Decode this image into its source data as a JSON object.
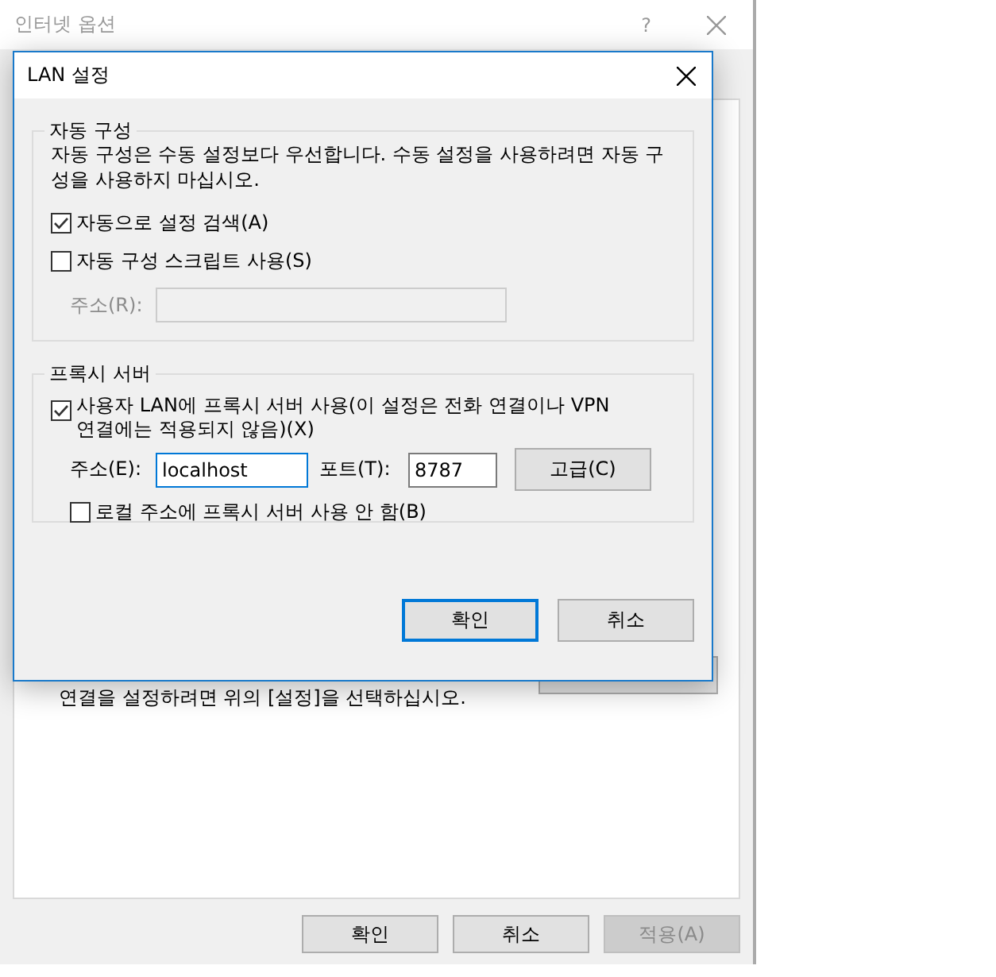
{
  "main_window": {
    "title": "인터넷 옵션",
    "help": "?",
    "body_text": "연결을 설정하려면 위의 [설정]을 선택하십시오.",
    "buttons": [
      {
        "label": "확인",
        "disabled": false
      },
      {
        "label": "취소",
        "disabled": false
      },
      {
        "label": "적용(A)",
        "disabled": true
      }
    ]
  },
  "dialog": {
    "title": "LAN 설정",
    "auto_config": {
      "title": "자동 구성",
      "description": "자동 구성은 수동 설정보다 우선합니다. 수동 설정을 사용하려면 자동 구성을 사용하지 마십시오.",
      "options": [
        {
          "label": "자동으로 설정 검색(A)",
          "checked": true
        },
        {
          "label": "자동 구성 스크립트 사용(S)",
          "checked": false
        }
      ],
      "address": {
        "label": "주소(R):",
        "disabled": true
      }
    },
    "proxy": {
      "title": "프록시 서버",
      "use_proxy": {
        "label": "사용자 LAN에 프록시 서버 사용(이 설정은 전화 연결이나 VPN 연결에는 적용되지 않음)(X)",
        "checked": true
      },
      "address": {
        "label": "주소(E):",
        "value": "localhost",
        "focused": true
      },
      "port": {
        "label": "포트(T):",
        "value": "8787",
        "focused": false
      },
      "advanced_button": "고급(C)",
      "bypass_local": {
        "label": "로컬 주소에 프록시 서버 사용 안 함(B)",
        "checked": false
      }
    },
    "buttons": [
      {
        "label": "확인",
        "default": true
      },
      {
        "label": "취소",
        "default": false
      }
    ]
  }
}
